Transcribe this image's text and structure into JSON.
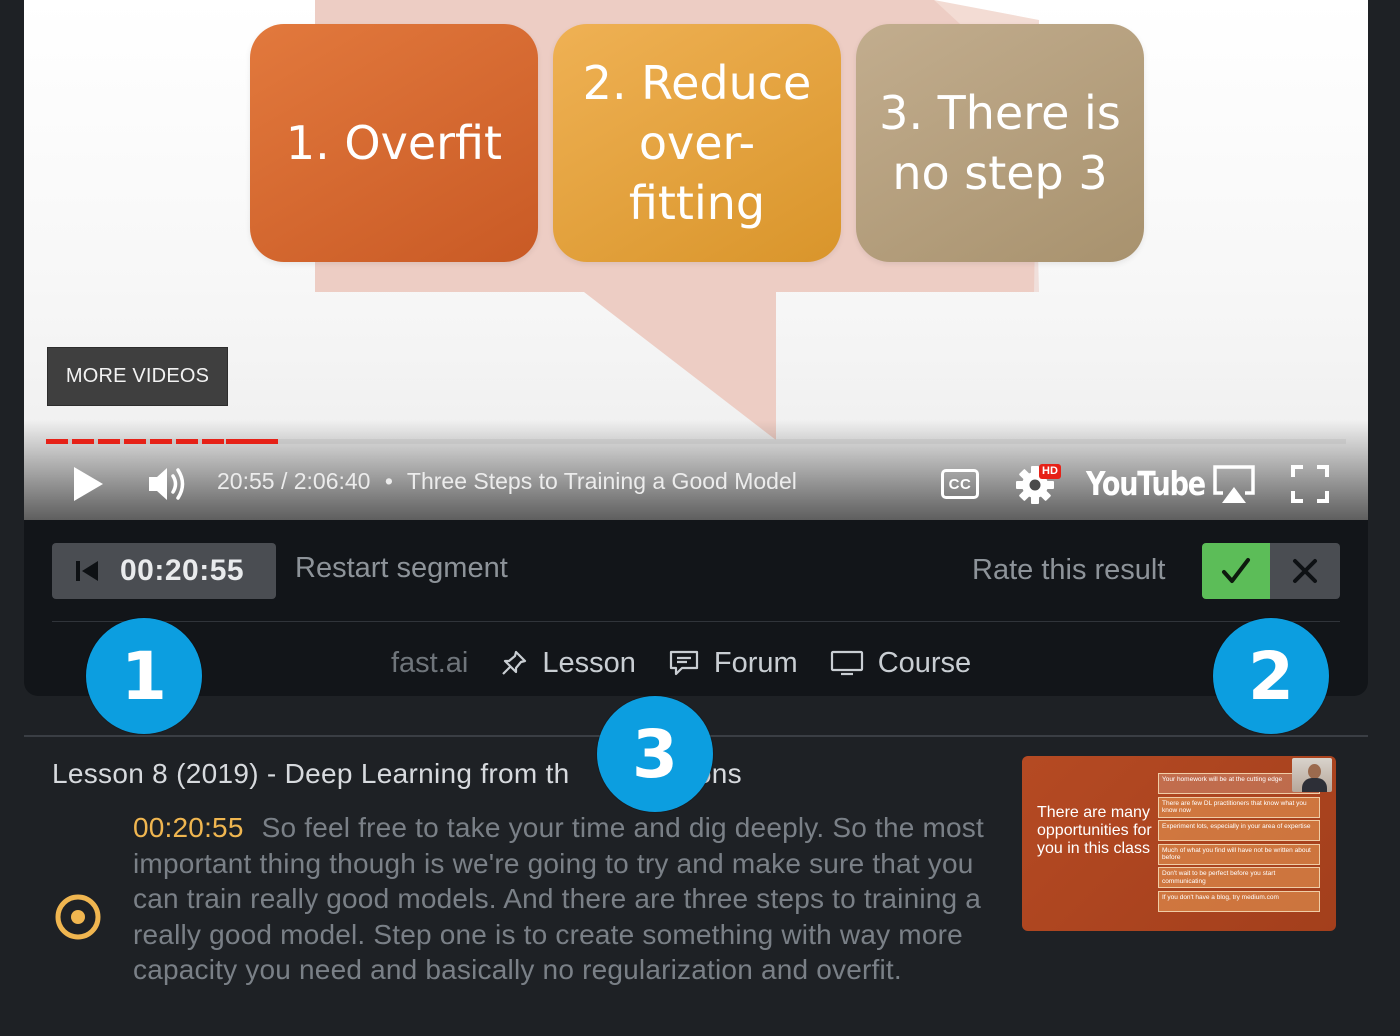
{
  "video": {
    "slide_boxes": [
      "1. Overfit",
      "2. Reduce\nover-\nfitting",
      "3. There is\nno step 3"
    ],
    "more_videos_label": "MORE VIDEOS",
    "progress_fraction": 0.165,
    "time_display": "20:55 / 2:06:40",
    "chapter_separator": "•",
    "chapter_title": "Three Steps to Training a Good Model",
    "cc_label": "CC",
    "hd_badge": "HD",
    "youtube_label": "YouTube",
    "accent_color": "#e62117"
  },
  "segment": {
    "restart_time": "00:20:55",
    "restart_label": "Restart segment",
    "rate_label": "Rate this result"
  },
  "links": {
    "brand": "fast.ai",
    "lesson": "Lesson",
    "forum": "Forum",
    "course": "Course"
  },
  "result": {
    "lesson_title": "Lesson 8 (2019) - Deep Learning from th",
    "lesson_title_tail": "dations",
    "timestamp": "00:20:55",
    "text": "So feel free to take your time and dig deeply. So the most important thing though is we're going to try and make sure that you can train really good models. And there are three steps to training a really good model. Step one is to create something with way more capacity you need and basically no regularization and overfit.",
    "timestamp_color": "#f0b650"
  },
  "thumbnail": {
    "text": "There are many opportunities for you in this class",
    "items": [
      "Your homework will be at the cutting edge",
      "There are few DL practitioners that know what you know now",
      "Experiment lots, especially in your area of expertise",
      "Much of what you find will have not be written about before",
      "Don't wait to be perfect before you start communicating",
      "If you don't have a blog, try medium.com"
    ]
  },
  "callouts": [
    "1",
    "2",
    "3"
  ],
  "callout_color": "#0c9ee0"
}
